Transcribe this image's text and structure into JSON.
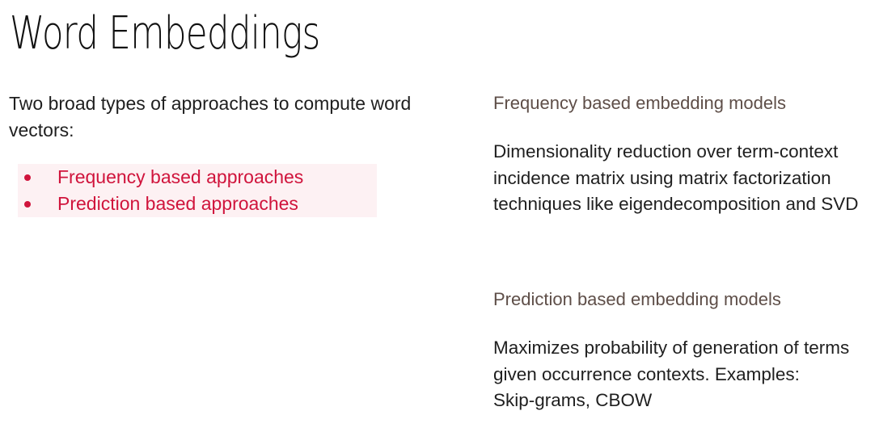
{
  "title": "Word Embeddings",
  "intro": "Two broad types of approaches to compute word vectors:",
  "bullets": [
    "Frequency based approaches",
    "Prediction based approaches"
  ],
  "colors": {
    "accent": "#d0143c",
    "highlight_background": "#fdf1f3",
    "section_heading": "#5e4e48",
    "text": "#1f1f1f"
  },
  "frequency_section": {
    "heading": "Frequency based embedding models",
    "body": "Dimensionality reduction over term-context\nincidence matrix using matrix factorization\ntechniques like eigendecomposition and SVD"
  },
  "prediction_section": {
    "heading": "Prediction based embedding models",
    "body": "Maximizes probability of generation of terms\ngiven occurrence contexts. Examples:\nSkip-grams, CBOW"
  }
}
